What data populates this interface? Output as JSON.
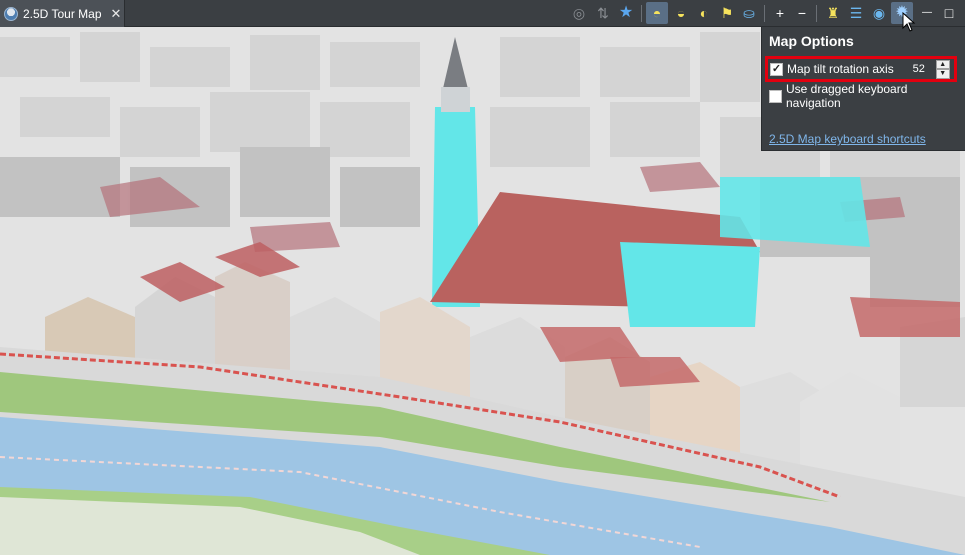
{
  "tab": {
    "title": "2.5D Tour Map",
    "close_glyph": "✕",
    "icon": "globe-icon"
  },
  "toolbar": {
    "tools": [
      {
        "name": "gps-icon",
        "glyph": "◎",
        "state": "disabled"
      },
      {
        "name": "pin-icon",
        "glyph": "⇅",
        "state": "disabled"
      },
      {
        "name": "star-icon",
        "glyph": "★",
        "state": "normal"
      },
      {
        "name": "dome-view-icon",
        "glyph": "◓",
        "state": "active"
      },
      {
        "name": "dome-tilt-icon",
        "glyph": "◒",
        "state": "normal"
      },
      {
        "name": "dome-flat-icon",
        "glyph": "◐",
        "state": "normal"
      },
      {
        "name": "flag-icon",
        "glyph": "⚑",
        "state": "normal"
      },
      {
        "name": "bucket-icon",
        "glyph": "⛀",
        "state": "normal"
      },
      {
        "name": "zoom-in-icon",
        "glyph": "+",
        "state": "normal"
      },
      {
        "name": "zoom-out-icon",
        "glyph": "−",
        "state": "normal"
      },
      {
        "name": "layers-icon",
        "glyph": "♜",
        "state": "normal"
      },
      {
        "name": "list-icon",
        "glyph": "☰",
        "state": "normal"
      },
      {
        "name": "target-icon",
        "glyph": "◉",
        "state": "normal"
      },
      {
        "name": "gear-icon",
        "glyph": "✹",
        "state": "active"
      },
      {
        "name": "minimize-icon",
        "glyph": "—",
        "state": "normal"
      },
      {
        "name": "maximize-icon",
        "glyph": "□",
        "state": "normal"
      }
    ]
  },
  "map_options": {
    "title": "Map Options",
    "tilt_label": "Map tilt rotation axis",
    "tilt_checked": true,
    "tilt_value": "52",
    "nav_label": "Use dragged keyboard navigation",
    "nav_checked": false,
    "shortcuts_link": "2.5D Map keyboard shortcuts"
  },
  "colors": {
    "toolbar_bg": "#3b3f43",
    "highlight_border": "#e3000f",
    "link": "#7fb6ea",
    "building_cyan": "#63e6e8",
    "roof_red": "#b8625f",
    "river": "#9ec5e4",
    "grass": "#9fc77d"
  }
}
